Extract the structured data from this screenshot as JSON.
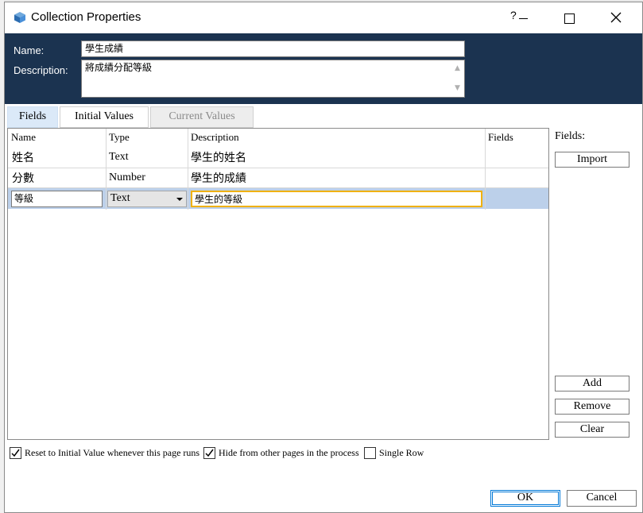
{
  "window": {
    "title": "Collection Properties",
    "help_glyph": "?"
  },
  "collection": {
    "name_label": "Name:",
    "name_value": "學生成績",
    "description_label": "Description:",
    "description_value": "將成績分配等級"
  },
  "tabs": [
    {
      "label": "Fields",
      "state": "active"
    },
    {
      "label": "Initial Values",
      "state": "normal"
    },
    {
      "label": "Current Values",
      "state": "disabled"
    }
  ],
  "grid": {
    "columns": [
      "Name",
      "Type",
      "Description",
      "Fields"
    ],
    "rows": [
      {
        "name": "姓名",
        "type": "Text",
        "description": "學生的姓名",
        "fields": ""
      },
      {
        "name": "分數",
        "type": "Number",
        "description": "學生的成績",
        "fields": ""
      }
    ],
    "editing_row": {
      "name": "等級",
      "type": "Text",
      "description": "學生的等級",
      "fields": ""
    }
  },
  "side": {
    "fields_label": "Fields:",
    "import_label": "Import",
    "add_label": "Add",
    "remove_label": "Remove",
    "clear_label": "Clear"
  },
  "options": [
    {
      "label": "Reset to Initial Value whenever this page runs",
      "checked": true
    },
    {
      "label": "Hide from other pages in the process",
      "checked": true
    },
    {
      "label": "Single Row",
      "checked": false
    }
  ],
  "footer": {
    "ok_label": "OK",
    "cancel_label": "Cancel"
  },
  "colors": {
    "header_bg": "#1b3350",
    "selected_row": "#bcd0ea",
    "focus_border": "#f0b100",
    "ok_border": "#0078d7"
  }
}
